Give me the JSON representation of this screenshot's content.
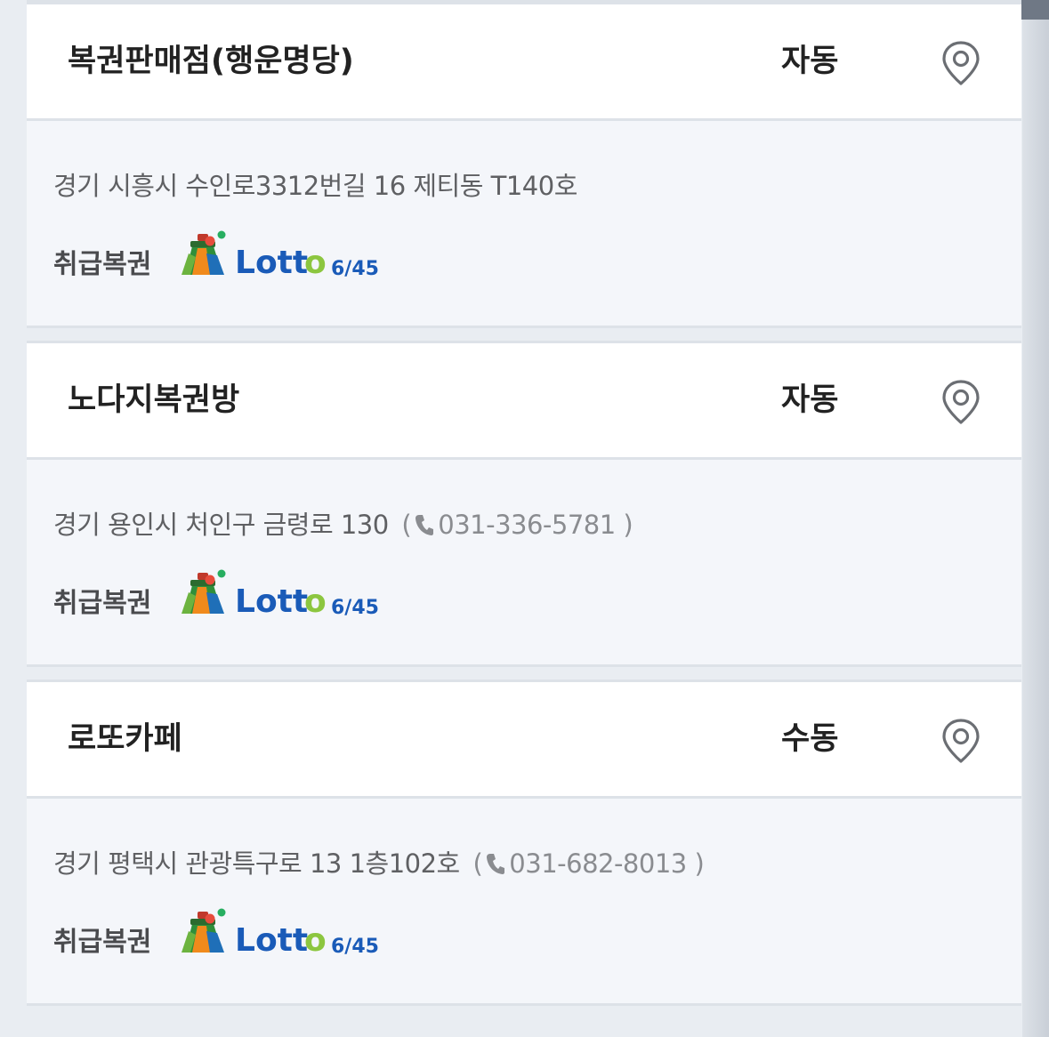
{
  "stores": [
    {
      "name": "복권판매점(행운명당)",
      "type": "자동",
      "address": "경기 시흥시 수인로3312번길 16 제티동 T140호",
      "phone": "",
      "handled_label": "취급복권",
      "lottery_logo": "Lotto 6/45"
    },
    {
      "name": "노다지복권방",
      "type": "자동",
      "address": "경기 용인시 처인구 금령로 130",
      "phone": "031-336-5781",
      "handled_label": "취급복권",
      "lottery_logo": "Lotto 6/45"
    },
    {
      "name": "로또카페",
      "type": "수동",
      "address": "경기 평택시 관광특구로 13 1층102호",
      "phone": "031-682-8013",
      "handled_label": "취급복권",
      "lottery_logo": "Lotto 6/45"
    }
  ],
  "icons": {
    "map": "map-pin-icon",
    "phone": "phone-icon",
    "logo": "lotto-645-logo"
  },
  "colors": {
    "lotto_blue": "#1a5bb8",
    "lotto_green": "#8cc63f",
    "pin_gray": "#6b6e73"
  }
}
